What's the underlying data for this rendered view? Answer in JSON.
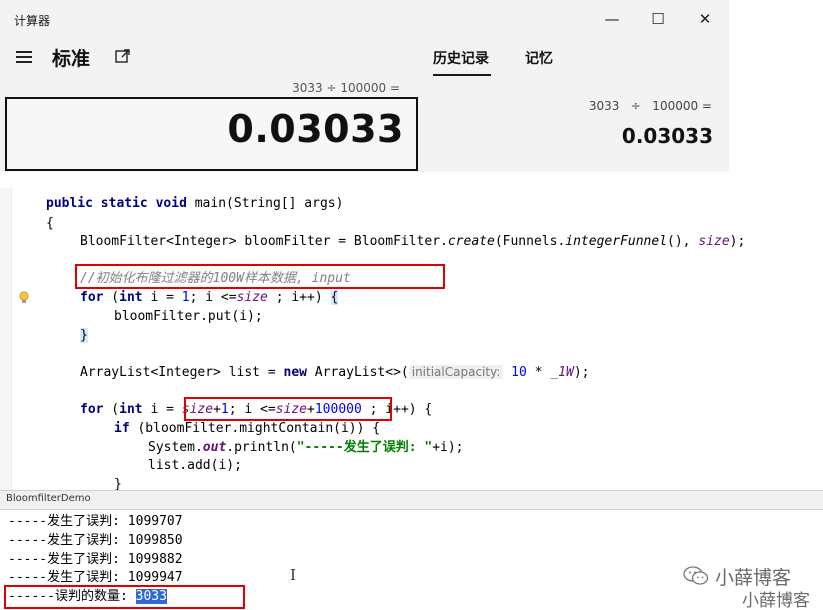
{
  "calculator": {
    "window_title": "计算器",
    "controls": {
      "minimize": "—",
      "maximize": "☐",
      "close": "✕"
    },
    "mode": "标准",
    "tabs": {
      "history": "历史记录",
      "memory": "记忆"
    },
    "expression": "3033 ÷ 100000 =",
    "display_value": "0.03033",
    "history": {
      "expression": "3033   ÷   100000 =",
      "result": "0.03033"
    },
    "icons": {
      "menu": "hamburger-icon",
      "keep_on_top": "keep-on-top-icon"
    }
  },
  "editor": {
    "lines": {
      "l0_kw1": "public",
      "l0_kw2": "static",
      "l0_kw3": "void",
      "l0_rest": "main(String[] args)",
      "l1": "{",
      "l2_a": "BloomFilter<Integer> bloomFilter = BloomFilter.",
      "l2_m1": "create",
      "l2_b": "(Funnels.",
      "l2_m2": "integerFunnel",
      "l2_c": "(), ",
      "l2_f": "size",
      "l2_d": ");",
      "l3_comment": "//初始化布隆过滤器的100W样本数据, input",
      "l4_kw1": "for",
      "l4_a": " (",
      "l4_kw2": "int",
      "l4_b": " i = ",
      "l4_n1": "1",
      "l4_c": "; i <=",
      "l4_f": "size",
      "l4_d": " ; i++) ",
      "l4_brace": "{",
      "l5": "bloomFilter.put(i);",
      "l6_brace": "}",
      "l7_a": "ArrayList<Integer> list = ",
      "l7_kw": "new",
      "l7_b": " ArrayList<>(",
      "l7_hint": "initialCapacity:",
      "l7_n": " 10",
      "l7_c": " * ",
      "l7_f": "_1W",
      "l7_d": ");",
      "l8_kw1": "for",
      "l8_a": " (",
      "l8_kw2": "int",
      "l8_b": " i = ",
      "l8_f1": "size",
      "l8_c": "+",
      "l8_n1": "1",
      "l8_d": "; i <=",
      "l8_f2": "size",
      "l8_e": "+",
      "l8_n2": "100000",
      "l8_g": " ; i++) {",
      "l9_kw": "if",
      "l9_a": " (bloomFilter.mightContain(i)) {",
      "l10_a": "System.",
      "l10_f": "out",
      "l10_b": ".println(",
      "l10_s": "\"-----发生了误判: \"",
      "l10_c": "+i);",
      "l11": "list.add(i);",
      "l12": "}"
    },
    "icons": {
      "gutter": "lightbulb-icon"
    },
    "highlight_color": "#e00000"
  },
  "run_panel": {
    "tab": "BloomfilterDemo",
    "output": [
      "-----发生了误判: 1099707",
      "-----发生了误判: 1099850",
      "-----发生了误判: 1099882",
      "-----发生了误判: 1099947"
    ],
    "count_label": "------误判的数量: ",
    "count_value": "3033",
    "cursor": "I",
    "watermark_1": "小薛博客",
    "watermark_2": "小薛博客",
    "icons": {
      "watermark": "wechat-icon"
    }
  }
}
